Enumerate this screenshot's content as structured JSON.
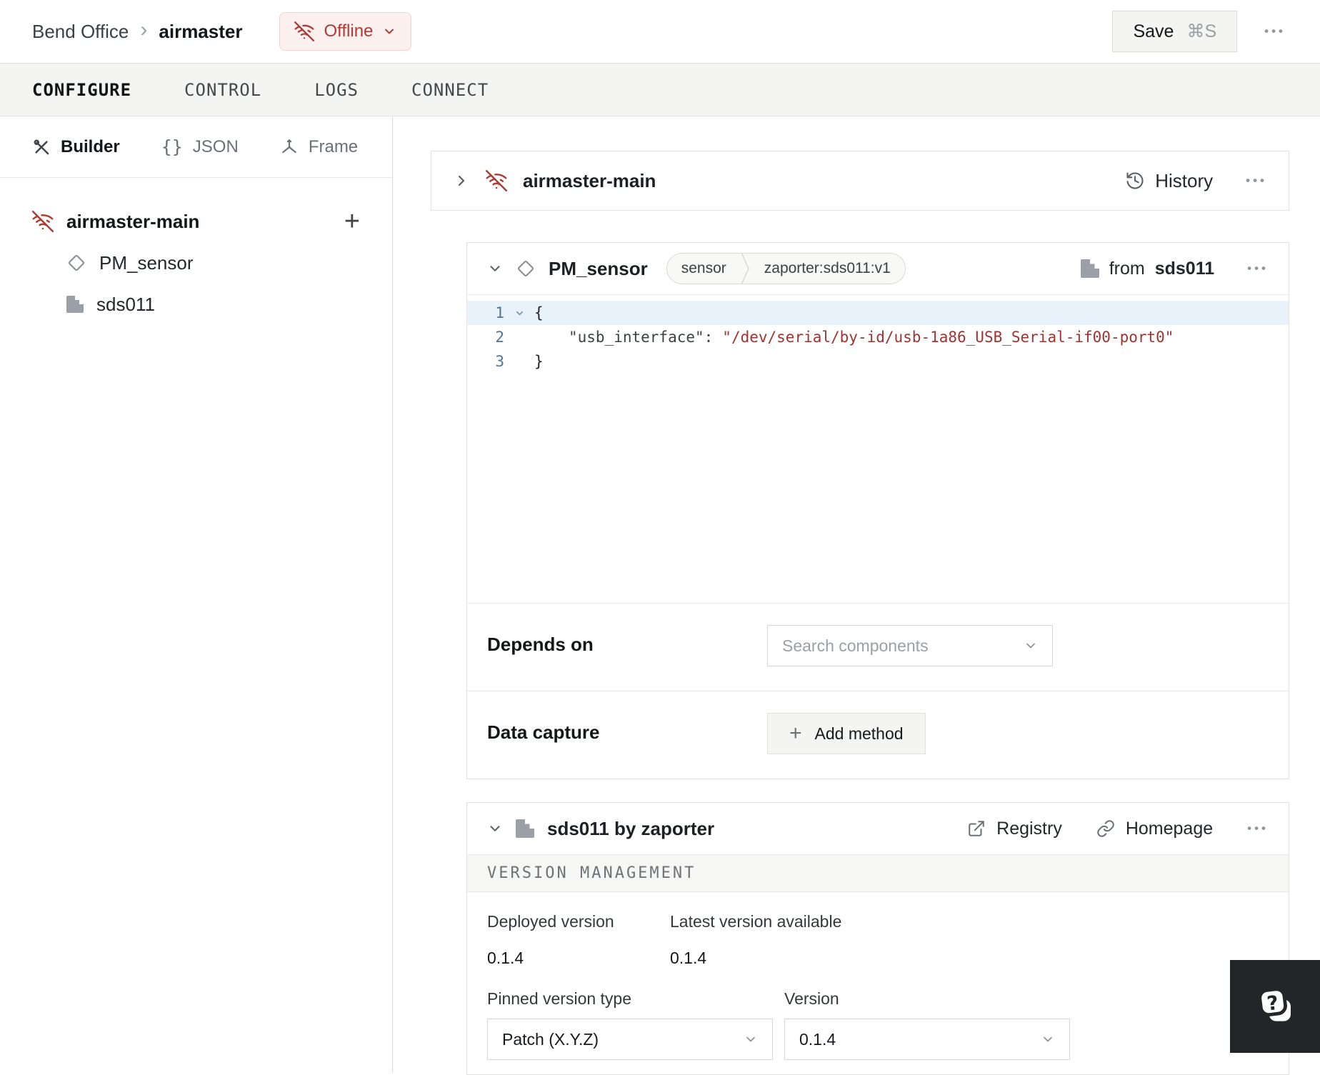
{
  "topbar": {
    "breadcrumb": {
      "parent": "Bend Office",
      "current": "airmaster"
    },
    "status_badge": {
      "label": "Offline"
    },
    "save_button": {
      "label": "Save",
      "shortcut": "⌘S"
    }
  },
  "tabs": {
    "configure": "CONFIGURE",
    "control": "CONTROL",
    "logs": "LOGS",
    "connect": "CONNECT"
  },
  "sidebar": {
    "views": {
      "builder": "Builder",
      "json": "JSON",
      "frame": "Frame"
    },
    "tree": {
      "machine": "airmaster-main",
      "component": "PM_sensor",
      "module": "sds011"
    }
  },
  "machine_card": {
    "title": "airmaster-main",
    "history": "History"
  },
  "component_card": {
    "title": "PM_sensor",
    "badge_type": "sensor",
    "badge_model": "zaporter:sds011:v1",
    "from_prefix": "from",
    "from_module": "sds011",
    "code": {
      "line_numbers": [
        "1",
        "2",
        "3"
      ],
      "line1": "{",
      "line2_key": "\"usb_interface\":",
      "line2_value": "\"/dev/serial/by-id/usb-1a86_USB_Serial-if00-port0\"",
      "line3": "}"
    },
    "depends_on": {
      "label": "Depends on",
      "placeholder": "Search components"
    },
    "data_capture": {
      "label": "Data capture",
      "add_button": "Add method"
    }
  },
  "module_card": {
    "title": "sds011 by zaporter",
    "registry": "Registry",
    "homepage": "Homepage",
    "section_title": "VERSION MANAGEMENT",
    "deployed_version": {
      "label": "Deployed version",
      "value": "0.1.4"
    },
    "latest_version": {
      "label": "Latest version available",
      "value": "0.1.4"
    },
    "pinned_type": {
      "label": "Pinned version type",
      "value": "Patch (X.Y.Z)"
    },
    "version": {
      "label": "Version",
      "value": "0.1.4"
    }
  },
  "icons": {
    "more": "•••",
    "plus": "+",
    "breadcrumb_separator": "›"
  },
  "colors": {
    "danger": "#b03a34",
    "danger_bg": "#fdf1f0",
    "code_string": "#9e3432",
    "line_number": "#4e7496"
  }
}
